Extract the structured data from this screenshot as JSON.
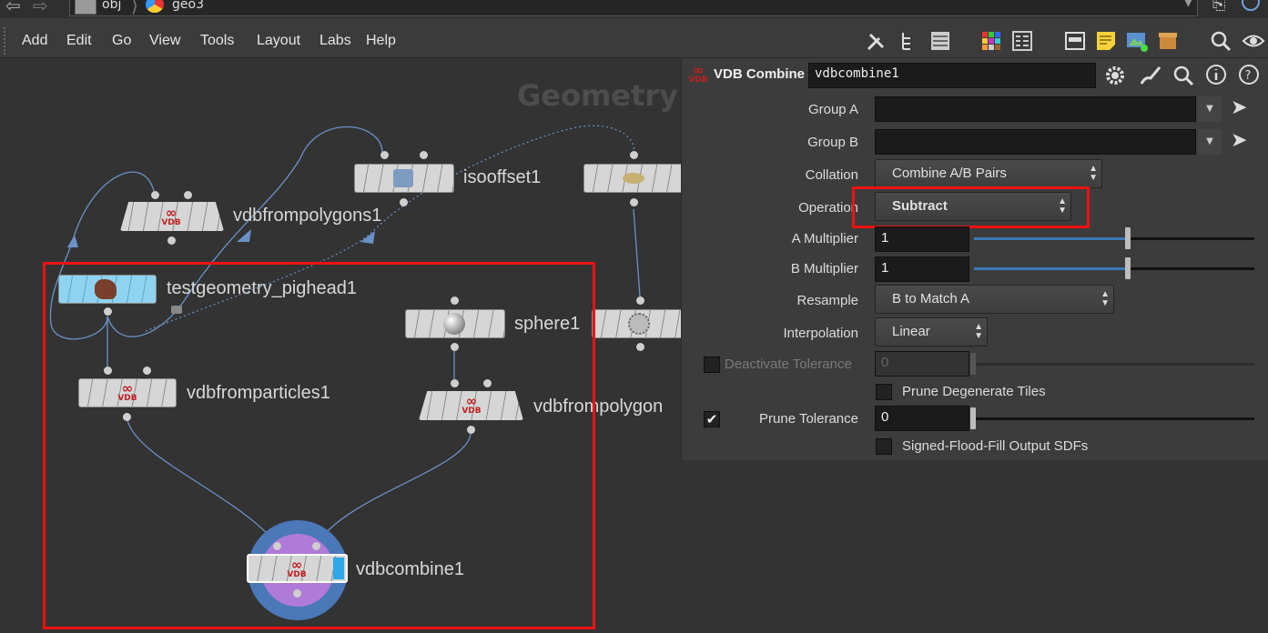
{
  "path_bar": {
    "segments": [
      "obj",
      "geo3"
    ]
  },
  "menu": [
    "Add",
    "Edit",
    "Go",
    "View",
    "Tools",
    "Layout",
    "Labs",
    "Help"
  ],
  "network": {
    "watermark": "Geometry",
    "nodes": {
      "vdbfrompolygons1": "vdbfrompolygons1",
      "isooffset1": "isooffset1",
      "testgeometry_pighead1": "testgeometry_pighead1",
      "sphere1": "sphere1",
      "vdbfromparticles1": "vdbfromparticles1",
      "vdbfrompolygons2": "vdbfrompolygon",
      "vdbcombine1": "vdbcombine1"
    },
    "vdb_badge": "VDB"
  },
  "panel": {
    "node_type": "VDB Combine",
    "node_name": "vdbcombine1",
    "params": {
      "group_a": {
        "label": "Group A",
        "value": ""
      },
      "group_b": {
        "label": "Group B",
        "value": ""
      },
      "collation": {
        "label": "Collation",
        "value": "Combine A/B Pairs"
      },
      "operation": {
        "label": "Operation",
        "value": "Subtract"
      },
      "a_multiplier": {
        "label": "A Multiplier",
        "value": "1",
        "slider_fraction": 0.54
      },
      "b_multiplier": {
        "label": "B Multiplier",
        "value": "1",
        "slider_fraction": 0.54
      },
      "resample": {
        "label": "Resample",
        "value": "B to Match A"
      },
      "interpolation": {
        "label": "Interpolation",
        "value": "Linear"
      },
      "deactivate_tolerance": {
        "label": "Deactivate Tolerance",
        "value": "0",
        "enabled": false
      },
      "prune_degenerate": {
        "label": "Prune Degenerate Tiles",
        "checked": false
      },
      "prune_tolerance": {
        "label": "Prune Tolerance",
        "value": "0",
        "checked": true
      },
      "signed_flood_fill": {
        "label": "Signed-Flood-Fill Output SDFs",
        "checked": false
      }
    }
  },
  "colors": {
    "highlight": "#ee1111",
    "slider_fill": "#3b78b7",
    "selected_node_ring": "#4a78b8"
  },
  "icons": [
    "back-arrow-icon",
    "forward-arrow-icon",
    "gear-icon",
    "search-icon",
    "info-icon",
    "help-icon",
    "pin-icon"
  ]
}
